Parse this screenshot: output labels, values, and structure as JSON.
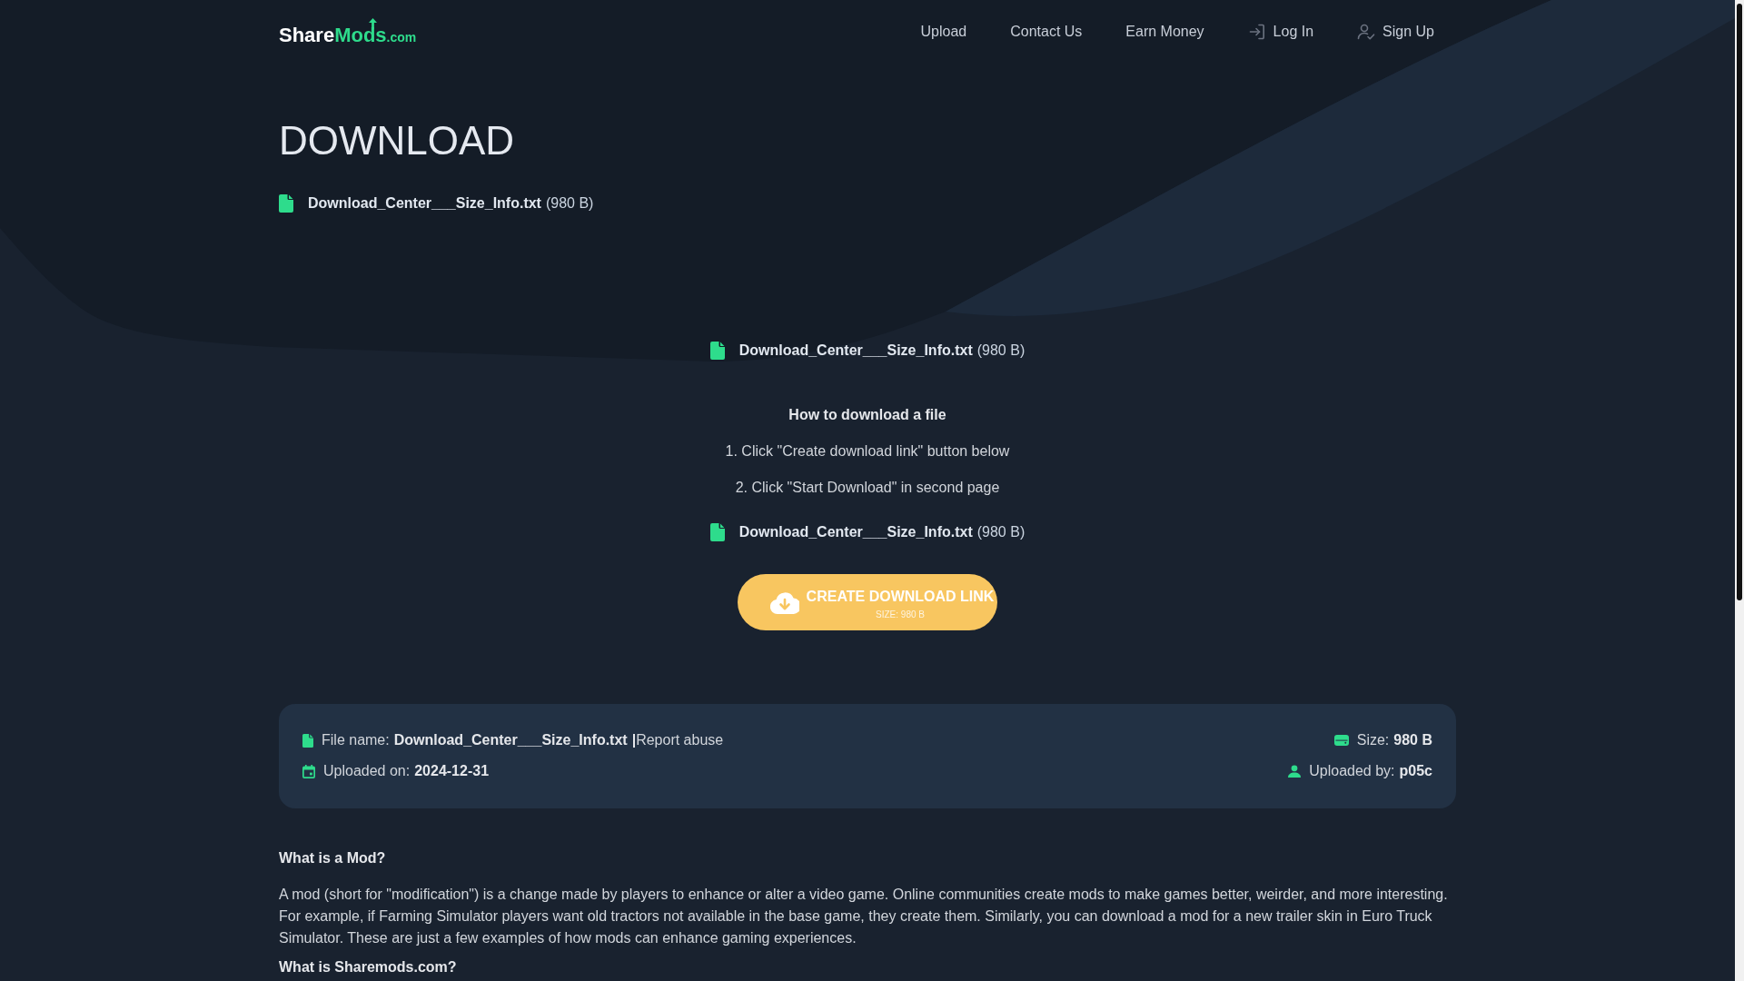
{
  "header": {
    "logo": {
      "text": "Share",
      "accent": "Mods",
      "suffix": ".com"
    },
    "nav": [
      {
        "label": "Upload",
        "kind": "link"
      },
      {
        "label": "Contact Us",
        "kind": "link"
      },
      {
        "label": "Earn Money",
        "kind": "link"
      },
      {
        "label": "Log In",
        "kind": "login"
      },
      {
        "label": "Sign Up",
        "kind": "signup"
      }
    ]
  },
  "title": "DOWNLOAD",
  "file": {
    "name": "Download_Center___Size_Info.txt",
    "size": "(980 B)"
  },
  "download_panel": {
    "file": {
      "name": "Download_Center___Size_Info.txt",
      "size": "(980 B)"
    },
    "heading": "How to download a file",
    "steps": [
      "1. Click \"Create download link\" button below",
      "2. Click \"Start Download\" in second page"
    ],
    "file_repeat": {
      "name": "Download_Center___Size_Info.txt",
      "size": "(980 B)"
    },
    "button": {
      "label": "CREATE DOWNLOAD LINK",
      "sublabel": "SIZE: 980 B"
    }
  },
  "file_info": {
    "file_name": {
      "label": "File name:",
      "value": "Download_Center___Size_Info.txt",
      "separator": "|",
      "link": "Report abuse"
    },
    "size": {
      "label": "Size:",
      "value": "980 B"
    },
    "uploaded_on": {
      "label": "Uploaded on:",
      "value": "2024-12-31"
    },
    "uploaded_by": {
      "label": "Uploaded by:",
      "value": "p05c"
    }
  },
  "about": [
    {
      "heading": "What is a Mod?",
      "text": "A mod (short for \"modification\") is a change made by players to enhance or alter a video game. Online communities create mods to make games better, weirder, and more interesting. For example, if Farming Simulator players want old tractors not available in the base game, they create them. Similarly, you can download a mod for a new trailer skin in Euro Truck Simulator. These are just a few examples of how mods can enhance gaming experiences."
    },
    {
      "heading": "What is Sharemods.com?"
    }
  ]
}
